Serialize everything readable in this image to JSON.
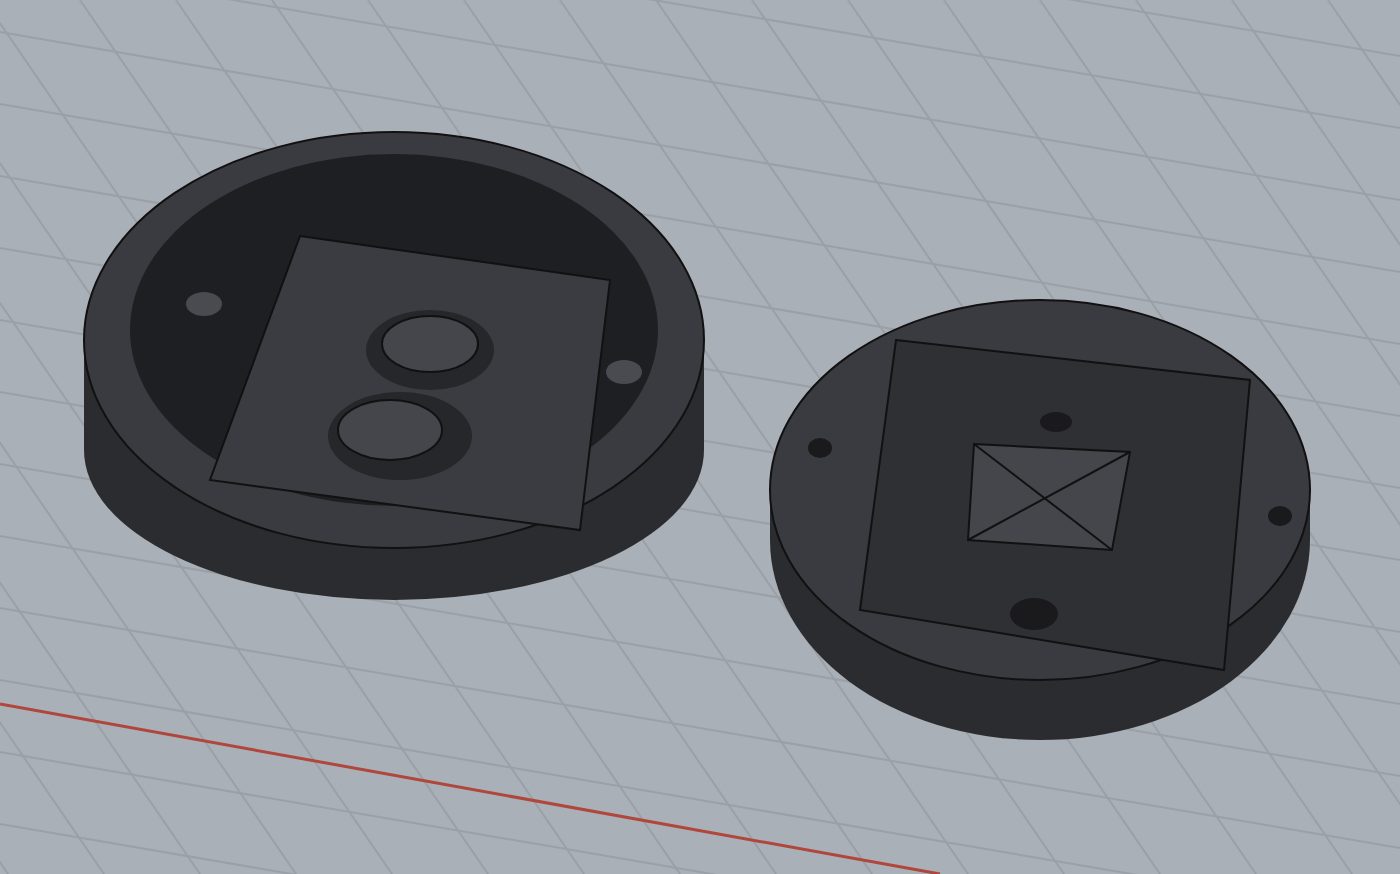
{
  "viewport": {
    "grid": true,
    "axis_line": true
  }
}
